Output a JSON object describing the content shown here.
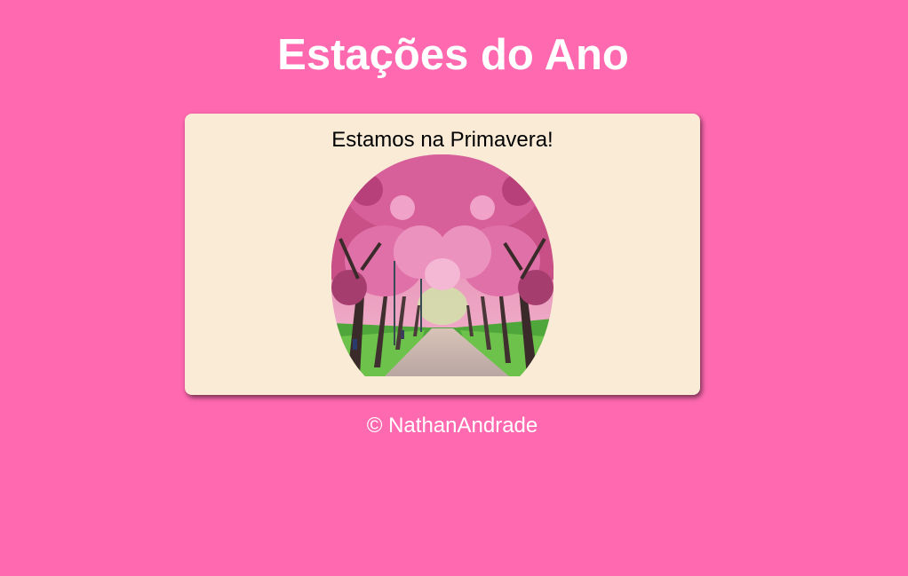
{
  "page": {
    "title": "Estações do Ano",
    "background_color": "#ff69b0"
  },
  "card": {
    "message": "Estamos na Primavera!",
    "background_color": "#faebd7",
    "image": {
      "icon": "cherry-blossom-path-photo"
    }
  },
  "footer": {
    "text": "© NathanAndrade"
  }
}
